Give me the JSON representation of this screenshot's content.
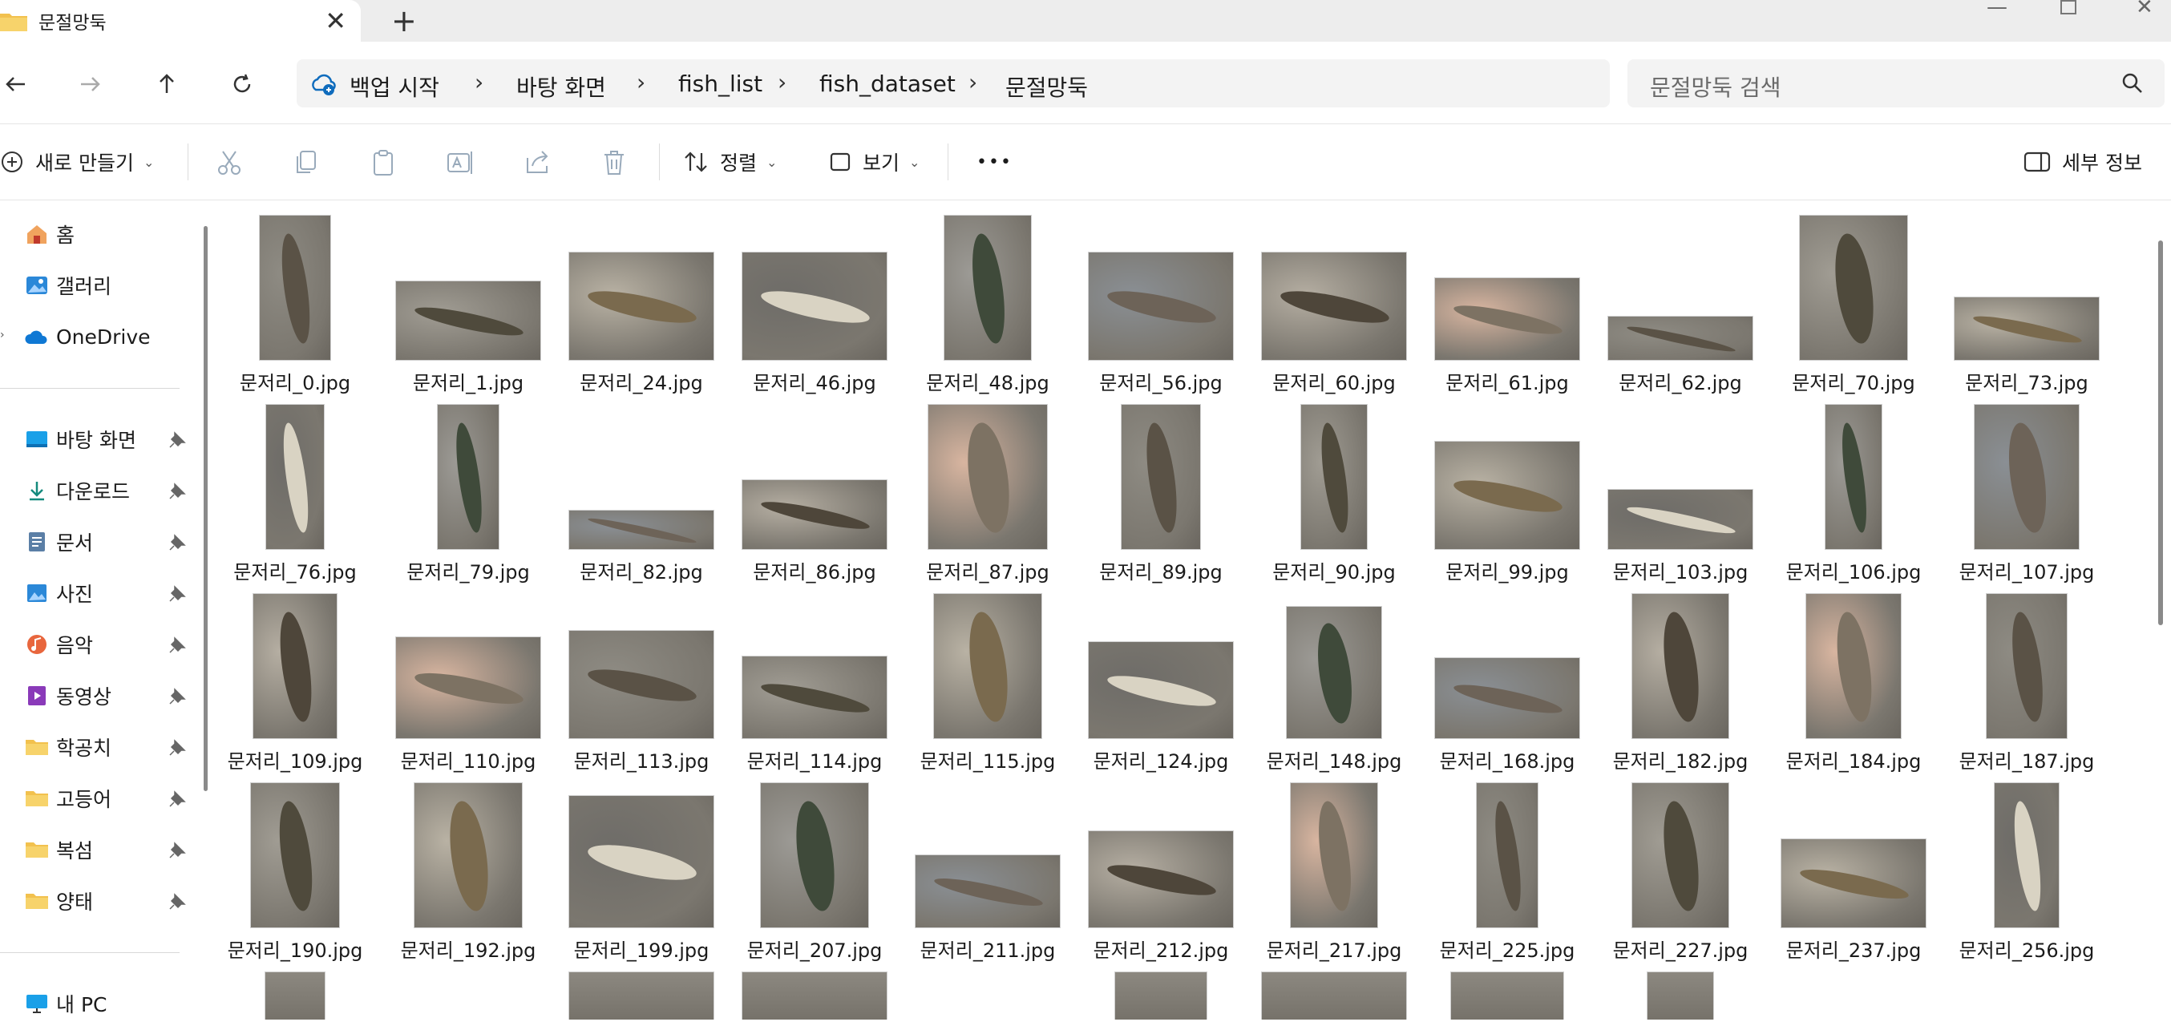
{
  "window": {
    "tab_title": "문절망둑",
    "new_tab": "+",
    "close_tab": "✕"
  },
  "nav": {
    "back": "←",
    "forward": "→",
    "up": "↑",
    "refresh": "↻"
  },
  "breadcrumb": [
    "백업 시작",
    "바탕 화면",
    "fish_list",
    "fish_dataset",
    "문절망둑"
  ],
  "search": {
    "placeholder": "문절망둑 검색"
  },
  "toolbar": {
    "new_label": "새로 만들기",
    "sort_label": "정렬",
    "view_label": "보기",
    "more_label": "•••",
    "details_label": "세부 정보"
  },
  "sidebar": {
    "top": [
      {
        "label": "홈",
        "icon": "home-icon"
      },
      {
        "label": "갤러리",
        "icon": "gallery-icon"
      },
      {
        "label": "OneDrive",
        "icon": "cloud-icon"
      }
    ],
    "pinned": [
      {
        "label": "바탕 화면",
        "icon": "desktop-icon"
      },
      {
        "label": "다운로드",
        "icon": "download-icon"
      },
      {
        "label": "문서",
        "icon": "document-icon"
      },
      {
        "label": "사진",
        "icon": "pictures-icon"
      },
      {
        "label": "음악",
        "icon": "music-icon"
      },
      {
        "label": "동영상",
        "icon": "video-icon"
      },
      {
        "label": "학공치",
        "icon": "folder-icon"
      },
      {
        "label": "고등어",
        "icon": "folder-icon"
      },
      {
        "label": "복섬",
        "icon": "folder-icon"
      },
      {
        "label": "양태",
        "icon": "folder-icon"
      }
    ],
    "bottom": [
      {
        "label": "내 PC",
        "icon": "pc-icon"
      }
    ]
  },
  "files": [
    "문저리_0.jpg",
    "문저리_1.jpg",
    "문저리_24.jpg",
    "문저리_46.jpg",
    "문저리_48.jpg",
    "문저리_56.jpg",
    "문저리_60.jpg",
    "문저리_61.jpg",
    "문저리_62.jpg",
    "문저리_70.jpg",
    "문저리_73.jpg",
    "문저리_76.jpg",
    "문저리_79.jpg",
    "문저리_82.jpg",
    "문저리_86.jpg",
    "문저리_87.jpg",
    "문저리_89.jpg",
    "문저리_90.jpg",
    "문저리_99.jpg",
    "문저리_103.jpg",
    "문저리_106.jpg",
    "문저리_107.jpg",
    "문저리_109.jpg",
    "문저리_110.jpg",
    "문저리_113.jpg",
    "문저리_114.jpg",
    "문저리_115.jpg",
    "문저리_124.jpg",
    "문저리_148.jpg",
    "문저리_168.jpg",
    "문저리_182.jpg",
    "문저리_184.jpg",
    "문저리_187.jpg",
    "문저리_190.jpg",
    "문저리_192.jpg",
    "문저리_199.jpg",
    "문저리_207.jpg",
    "문저리_211.jpg",
    "문저리_212.jpg",
    "문저리_217.jpg",
    "문저리_225.jpg",
    "문저리_227.jpg",
    "문저리_237.jpg",
    "문저리_256.jpg"
  ]
}
